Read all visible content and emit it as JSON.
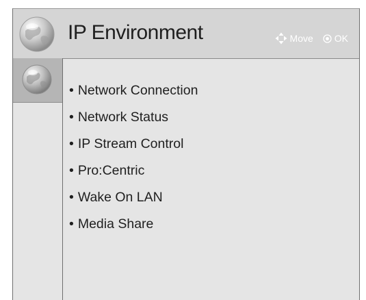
{
  "header": {
    "title": "IP Environment",
    "globe_icon": "globe-icon"
  },
  "hints": {
    "move": {
      "icon": "four-way-arrows-icon",
      "label": "Move"
    },
    "ok": {
      "icon": "ok-circle-icon",
      "label": "OK"
    }
  },
  "sidebar": {
    "selected_icon": "globe-icon"
  },
  "menu": {
    "bullet": "•",
    "items": [
      {
        "label": "Network Connection"
      },
      {
        "label": "Network Status"
      },
      {
        "label": "IP Stream Control"
      },
      {
        "label": "Pro:Centric"
      },
      {
        "label": "Wake On LAN"
      },
      {
        "label": "Media Share"
      }
    ]
  },
  "colors": {
    "header_bg": "#d5d5d5",
    "panel_bg": "#e5e5e5",
    "selected_icon_bg": "#b5b5b5",
    "text": "#1f1f1f",
    "hint_text": "#ffffff"
  }
}
